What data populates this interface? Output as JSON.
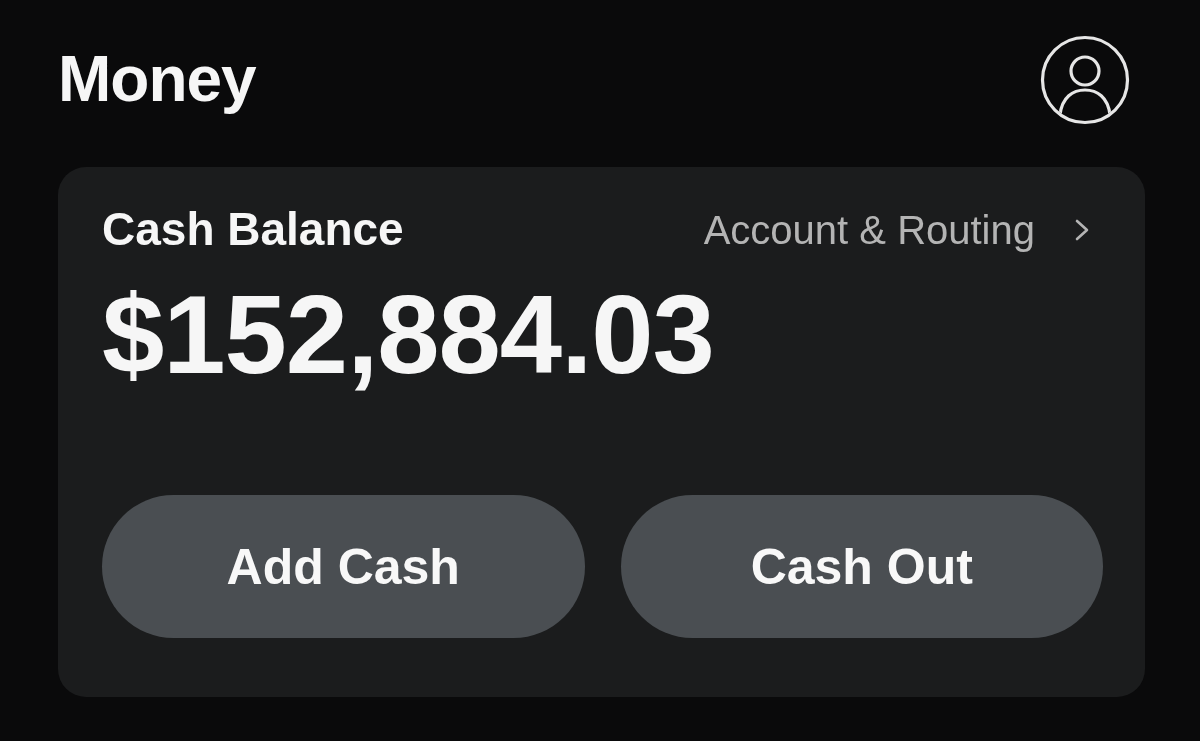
{
  "header": {
    "title": "Money"
  },
  "balance_card": {
    "label": "Cash Balance",
    "link": "Account & Routing",
    "amount": "$152,884.03"
  },
  "actions": [
    "Add Cash",
    "Cash Out"
  ]
}
